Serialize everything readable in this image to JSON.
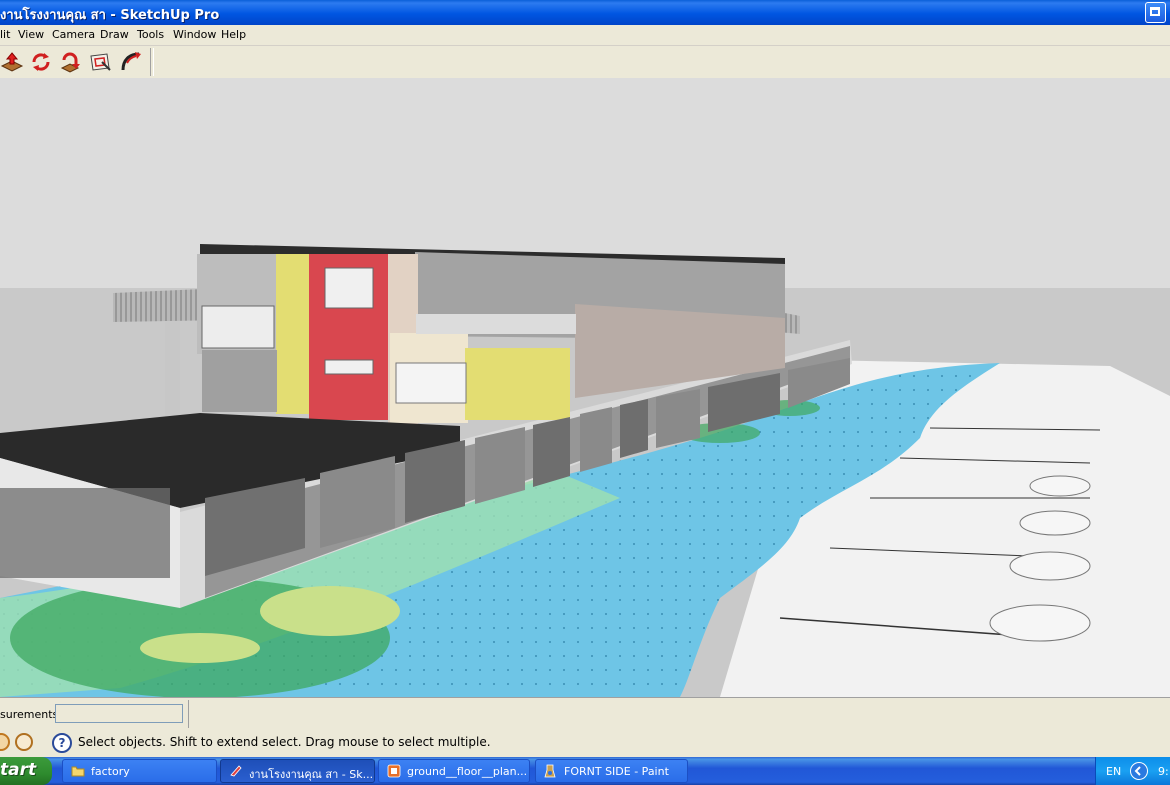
{
  "window": {
    "title": "งานโรงงานคุณ สา - SketchUp Pro"
  },
  "menu": {
    "items": [
      "lit",
      "View",
      "Camera",
      "Draw",
      "Tools",
      "Window",
      "Help"
    ]
  },
  "toolbar": {
    "tools": [
      "push-pull-icon",
      "rotate-icon",
      "follow-me-icon",
      "offset-icon",
      "tape-measure-icon"
    ]
  },
  "viewport": {
    "sky_color": "#DCDCDC",
    "ground_color": "#C9C9C9",
    "water_color": "#6EC5E6",
    "wall_red": "#D9474F",
    "wall_yellow": "#E3DD72"
  },
  "status": {
    "measurements_label": "surements",
    "measurements_value": "",
    "message": "Select objects. Shift to extend select. Drag mouse to select multiple."
  },
  "taskbar": {
    "start_label": "tart",
    "tasks": [
      {
        "label": "factory",
        "icon": "folder-icon"
      },
      {
        "label": "งานโรงงานคุณ สา - Sk...",
        "icon": "sketchup-icon"
      },
      {
        "label": "ground__floor__plan...",
        "icon": "layout-icon"
      },
      {
        "label": "FORNT SIDE - Paint",
        "icon": "paint-icon"
      }
    ],
    "language": "EN",
    "clock": "9:"
  }
}
